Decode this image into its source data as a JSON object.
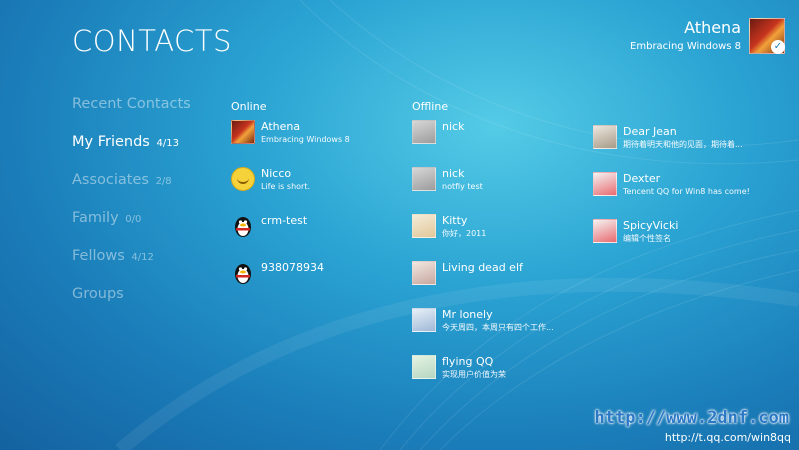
{
  "page": {
    "title": "CONTACTS"
  },
  "user": {
    "name": "Athena",
    "status": "Embracing Windows 8",
    "avatar_icon": "user-avatar-icon"
  },
  "groups": [
    {
      "label": "Recent Contacts",
      "count": ""
    },
    {
      "label": "My Friends",
      "count": "4/13",
      "active": true
    },
    {
      "label": "Associates",
      "count": "2/8"
    },
    {
      "label": "Family",
      "count": "0/0"
    },
    {
      "label": "Fellows",
      "count": "4/12"
    },
    {
      "label": "Groups",
      "count": ""
    }
  ],
  "online": {
    "header": "Online",
    "contacts": [
      {
        "name": "Athena",
        "status": "Embracing Windows 8",
        "avatar": "athena"
      },
      {
        "name": "Nicco",
        "status": "Life is short.",
        "avatar": "smile"
      },
      {
        "name": "crm-test",
        "status": "",
        "avatar": "penguin"
      },
      {
        "name": "938078934",
        "status": "",
        "avatar": "penguin"
      }
    ]
  },
  "offline": {
    "header": "Offline",
    "contacts": [
      {
        "name": "nick",
        "status": "",
        "avatar": "gray"
      },
      {
        "name": "nick",
        "status": "notfiy test",
        "avatar": "gray"
      },
      {
        "name": "Kitty",
        "status": "你好，2011",
        "avatar": "kitty"
      },
      {
        "name": "Living dead elf",
        "status": "",
        "avatar": "elf"
      },
      {
        "name": "Mr lonely",
        "status": "今天周四，本周只有四个工作...",
        "avatar": "lonely"
      },
      {
        "name": "flying QQ",
        "status": "实现用户价值为荣",
        "avatar": "flying"
      }
    ],
    "more": [
      {
        "name": "Dear Jean",
        "status": "期待着明天和他的见面，期待着...",
        "avatar": "jean"
      },
      {
        "name": "Dexter",
        "status": "Tencent QQ for Win8 has come!",
        "avatar": "pink"
      },
      {
        "name": "SpicyVicki",
        "status": "编辑个性签名",
        "avatar": "pink"
      }
    ]
  },
  "watermark": {
    "brand": "http://www.2dnf.com",
    "url": "http://t.qq.com/win8qq"
  }
}
